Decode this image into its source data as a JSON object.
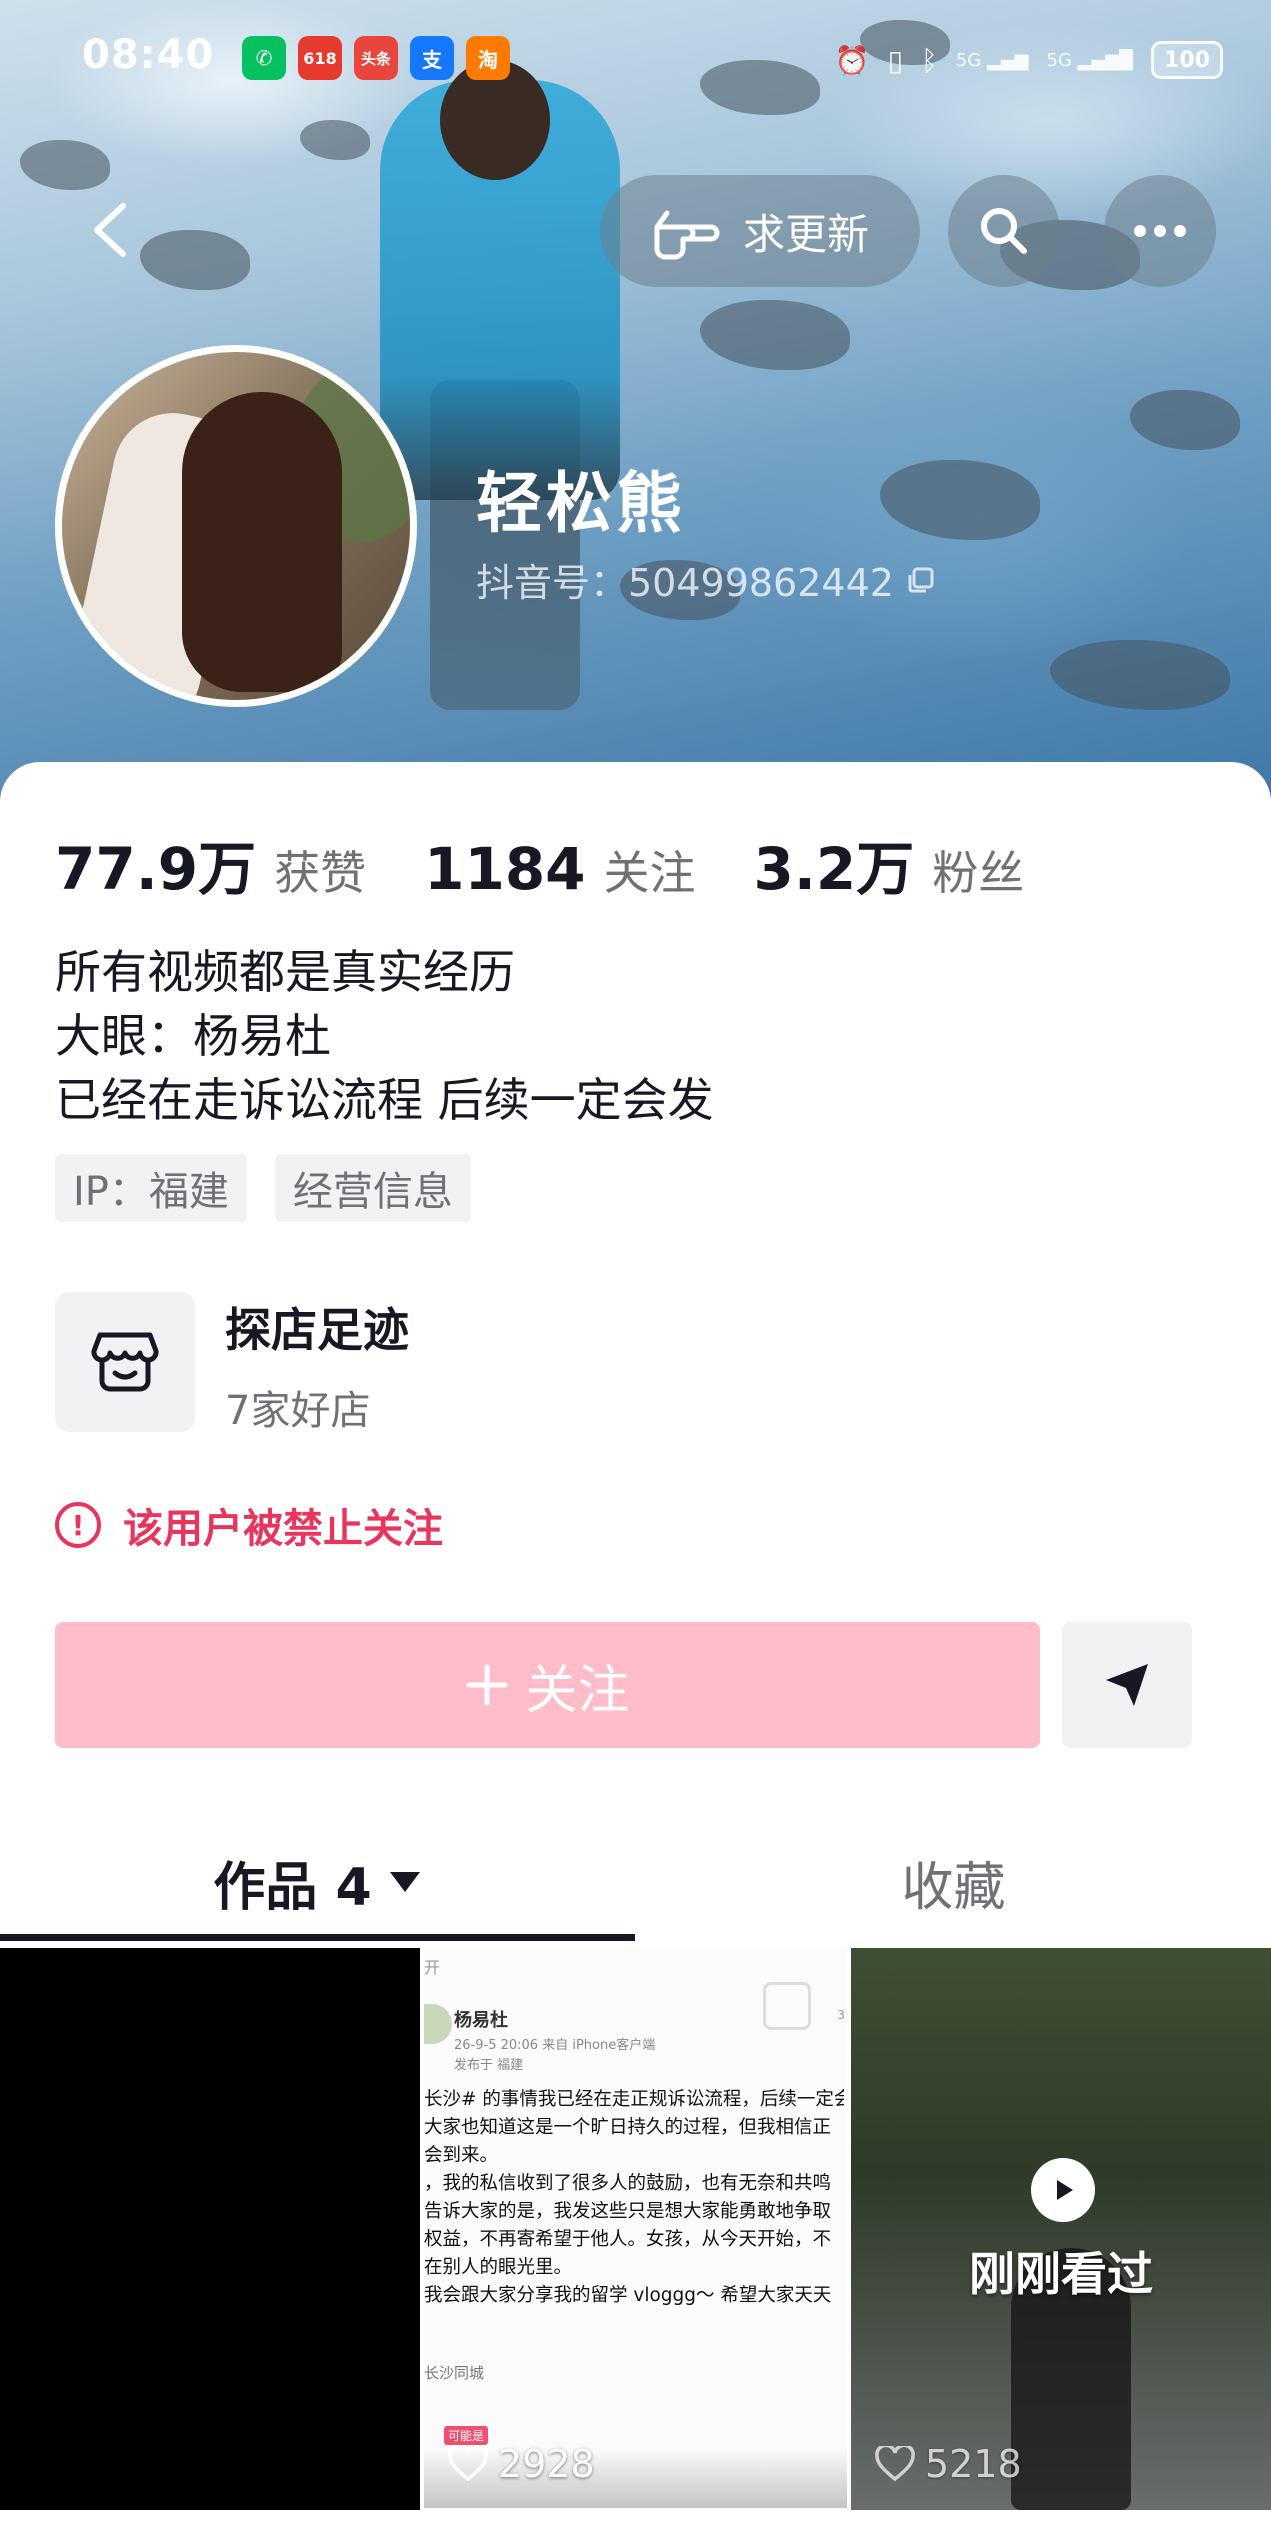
{
  "status_bar": {
    "time": "08:40",
    "app_icons": [
      {
        "name": "wechat-icon",
        "glyph": "✆",
        "color": "#07c160"
      },
      {
        "name": "618-app-icon",
        "glyph": "618",
        "color": "#e63a2e"
      },
      {
        "name": "toutiao-icon",
        "glyph": "头条",
        "color": "#e8453c"
      },
      {
        "name": "alipay-icon",
        "glyph": "支",
        "color": "#1677ff"
      },
      {
        "name": "taobao-icon",
        "glyph": "淘",
        "color": "#ff7a00"
      }
    ],
    "network_1": "5G",
    "network_2": "5G",
    "battery": "100"
  },
  "header": {
    "update_button_label": "求更新"
  },
  "profile": {
    "name": "轻松熊",
    "douyin_id": "抖音号：50499862442"
  },
  "stats": {
    "likes_value": "77.9万",
    "likes_label": "获赞",
    "following_value": "1184",
    "following_label": "关注",
    "followers_value": "3.2万",
    "followers_label": "粉丝"
  },
  "bio": {
    "line1": "所有视频都是真实经历",
    "line2": "大眼：杨易杜",
    "line3": "已经在走诉讼流程 后续一定会发"
  },
  "tags": {
    "ip": "IP：福建",
    "business": "经营信息"
  },
  "shop": {
    "title": "探店足迹",
    "subtitle": "7家好店"
  },
  "ban_notice": "该用户被禁止关注",
  "actions": {
    "follow_label": "关注"
  },
  "tabs": {
    "works_label": "作品 4",
    "favorites_label": "收藏"
  },
  "videos": {
    "tile2": {
      "header": "开",
      "user": "杨易杜",
      "meta": "26-9-5 20:06 来自 iPhone客户端",
      "location": "发布于 福建",
      "body": "长沙# 的事情我已经在走正规诉讼流程，后续一定会\n大家也知道这是一个旷日持久的过程，但我相信正\n会到来。\n，我的私信收到了很多人的鼓励，也有无奈和共鸣\n告诉大家的是，我发这些只是想大家能勇敢地争取\n权益，不再寄希望于他人。女孩，从今天开始，不\n在别人的眼光里。\n我会跟大家分享我的留学 vloggg～ 希望大家天天",
      "footer": "长沙同城",
      "tag": "可能是",
      "edge": "3",
      "likes": "2928"
    },
    "tile3": {
      "watched_label": "刚刚看过",
      "likes": "5218"
    }
  },
  "colors": {
    "accent_pink": "#e8355e",
    "follow_button": "#ffbcc9",
    "text_primary": "#161823",
    "text_secondary": "#6f7177"
  }
}
